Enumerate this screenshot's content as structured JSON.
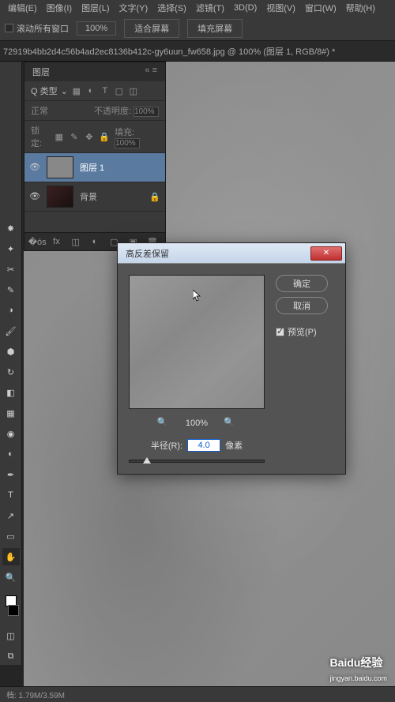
{
  "menu": {
    "items": [
      "编辑(E)",
      "图像(I)",
      "图层(L)",
      "文字(Y)",
      "选择(S)",
      "滤镜(T)",
      "3D(D)",
      "视图(V)",
      "窗口(W)",
      "帮助(H)"
    ]
  },
  "options": {
    "scroll_all": "滚动所有窗口",
    "zoom": "100%",
    "fit_screen": "适合屏幕",
    "fill_screen": "填充屏幕"
  },
  "tab": {
    "title": "72919b4bb2d4c56b4ad2ec8136b412c-gy6uun_fw658.jpg @ 100% (图层 1, RGB/8#) *"
  },
  "layers": {
    "title": "图层",
    "kind": "Q 类型",
    "blend_mode": "正常",
    "opacity_label": "不透明度:",
    "opacity_value": "100%",
    "lock_label": "锁定:",
    "fill_label": "填充:",
    "fill_value": "100%",
    "items": [
      {
        "name": "图层 1",
        "locked": false
      },
      {
        "name": "背景",
        "locked": true
      }
    ]
  },
  "dialog": {
    "title": "高反差保留",
    "ok": "确定",
    "cancel": "取消",
    "preview": "预览(P)",
    "zoom": "100%",
    "radius_label": "半径(R):",
    "radius_value": "4.0",
    "radius_unit": "像素"
  },
  "status": {
    "text": "档: 1.79M/3.59M"
  },
  "watermark": {
    "brand": "Baidu经验",
    "sub": "jingyan.baidu.com"
  }
}
